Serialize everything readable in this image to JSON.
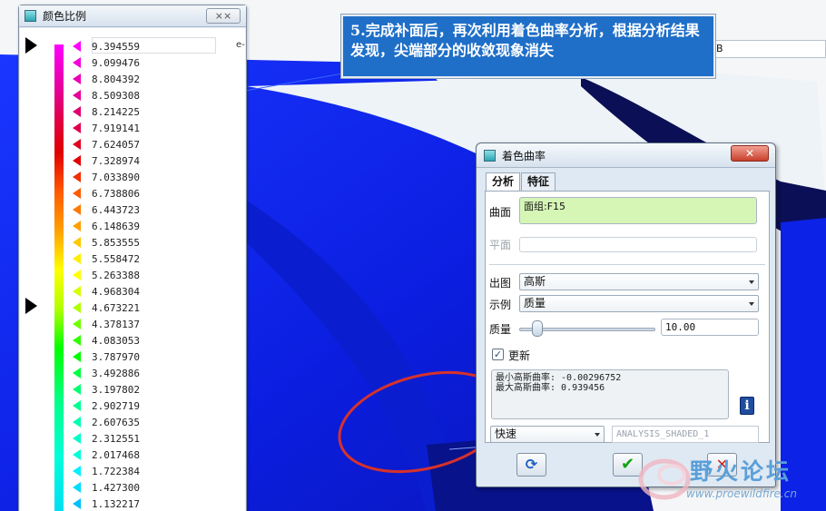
{
  "scale_window": {
    "title": "颜色比例",
    "close_glyph": "⨯⨯",
    "top_value": "9.394559",
    "exp_label": "e-",
    "ticks": [
      {
        "value": "9.394559",
        "color": "#ff00ff"
      },
      {
        "value": "9.099476",
        "color": "#f400d8"
      },
      {
        "value": "8.804392",
        "color": "#ec00b4"
      },
      {
        "value": "8.509308",
        "color": "#e6009a"
      },
      {
        "value": "8.214225",
        "color": "#e00070"
      },
      {
        "value": "7.919141",
        "color": "#e0004a"
      },
      {
        "value": "7.624057",
        "color": "#e00020"
      },
      {
        "value": "7.328974",
        "color": "#e00000"
      },
      {
        "value": "7.033890",
        "color": "#f03000"
      },
      {
        "value": "6.738806",
        "color": "#ff5a00"
      },
      {
        "value": "6.443723",
        "color": "#ff7a00"
      },
      {
        "value": "6.148639",
        "color": "#ffa000"
      },
      {
        "value": "5.853555",
        "color": "#ffc800"
      },
      {
        "value": "5.558472",
        "color": "#ffee00"
      },
      {
        "value": "5.263388",
        "color": "#ffff00"
      },
      {
        "value": "4.968304",
        "color": "#d8ff00"
      },
      {
        "value": "4.673221",
        "color": "#b0ff00"
      },
      {
        "value": "4.378137",
        "color": "#70ff00"
      },
      {
        "value": "4.083053",
        "color": "#30ff00"
      },
      {
        "value": "3.787970",
        "color": "#00ff00"
      },
      {
        "value": "3.492886",
        "color": "#00ff40"
      },
      {
        "value": "3.197802",
        "color": "#00ff70"
      },
      {
        "value": "2.902719",
        "color": "#00ff90"
      },
      {
        "value": "2.607635",
        "color": "#00ffb0"
      },
      {
        "value": "2.312551",
        "color": "#00ffc8"
      },
      {
        "value": "2.017468",
        "color": "#00ffd8"
      },
      {
        "value": "1.722384",
        "color": "#00f0ff"
      },
      {
        "value": "1.427300",
        "color": "#00dcff"
      },
      {
        "value": "1.132217",
        "color": "#00c0ff"
      }
    ]
  },
  "caption": {
    "text": "5.完成补面后，再次利用着色曲率分析，根据分析结果发现，尖端部分的收敛现象消失"
  },
  "dialog": {
    "title": "着色曲率",
    "close_glyph": "✕",
    "tabs": [
      {
        "label": "分析"
      },
      {
        "label": "特征"
      }
    ],
    "surface_label": "曲面",
    "surface_value": "面组:F15",
    "plane_label": "平面",
    "plot_label": "出图",
    "plot_value": "高斯",
    "example_label": "示例",
    "example_value": "质量",
    "quality_label": "质量",
    "quality_value": "10.00",
    "quality_fraction": 0.1,
    "update_label": "更新",
    "update_checked": true,
    "result_line1": "最小高斯曲率: -0.00296752",
    "result_line2": "最大高斯曲率: 0.939456",
    "info_glyph": "i",
    "mode_value": "快速",
    "analysis_name": "ANALYSIS_SHADED_1",
    "repeat_glyph": "⟳",
    "ok_glyph": "✔",
    "cancel_glyph": "✕"
  },
  "background_field": {
    "text": "B"
  },
  "watermark": {
    "title": "野火论坛",
    "url": "www.proewildfire.cn"
  },
  "colors": {
    "model_blue": "#0a1ee8",
    "dark_blue": "#070a5a",
    "annotation_red": "#d6322b",
    "caption_blue": "#1f6fc8"
  }
}
